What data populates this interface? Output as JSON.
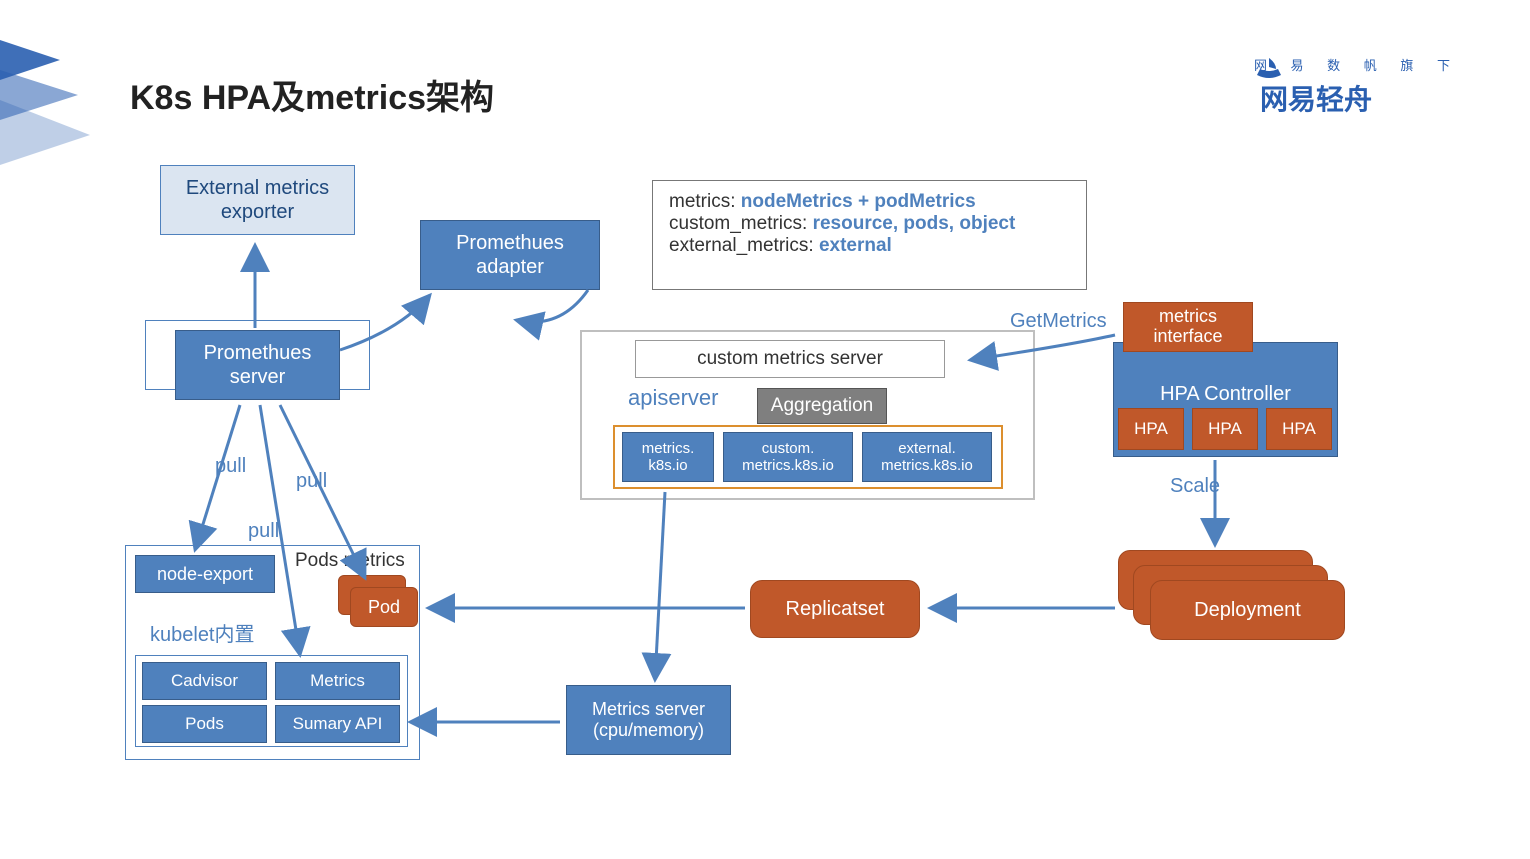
{
  "title": "K8s HPA及metrics架构",
  "logo": {
    "small": "网 易 数 帆 旗 下",
    "big": "网易轻舟"
  },
  "boxes": {
    "external_exporter": "External metrics exporter",
    "prom_adapter": "Promethues adapter",
    "prom_server": "Promethues server",
    "node_export": "node-export",
    "pod": "Pod",
    "cadvisor": "Cadvisor",
    "pods": "Pods",
    "metrics": "Metrics",
    "summary": "Sumary API",
    "kubelet": "kubelet内置",
    "pods_metrics": "Pods metrics",
    "custom_metrics_server": "custom metrics server",
    "apiserver": "apiserver",
    "aggregation": "Aggregation",
    "metrics_k8s": "metrics.\nk8s.io",
    "custom_k8s": "custom.\nmetrics.k8s.io",
    "external_k8s": "external.\nmetrics.k8s.io",
    "metrics_server": "Metrics server\n(cpu/memory)",
    "replicaset": "Replicatset",
    "metrics_interface": "metrics interface",
    "hpa_controller": "HPA Controller",
    "hpa": "HPA",
    "deployment": "Deployment"
  },
  "legend": {
    "l1a": "metrics:  ",
    "l1b": "nodeMetrics + podMetrics",
    "l2a": "custom_metrics:  ",
    "l2b": "resource, pods, object",
    "l3a": "external_metrics:  ",
    "l3b": "external"
  },
  "labels": {
    "pull": "pull",
    "getmetrics": "GetMetrics",
    "scale": "Scale"
  }
}
